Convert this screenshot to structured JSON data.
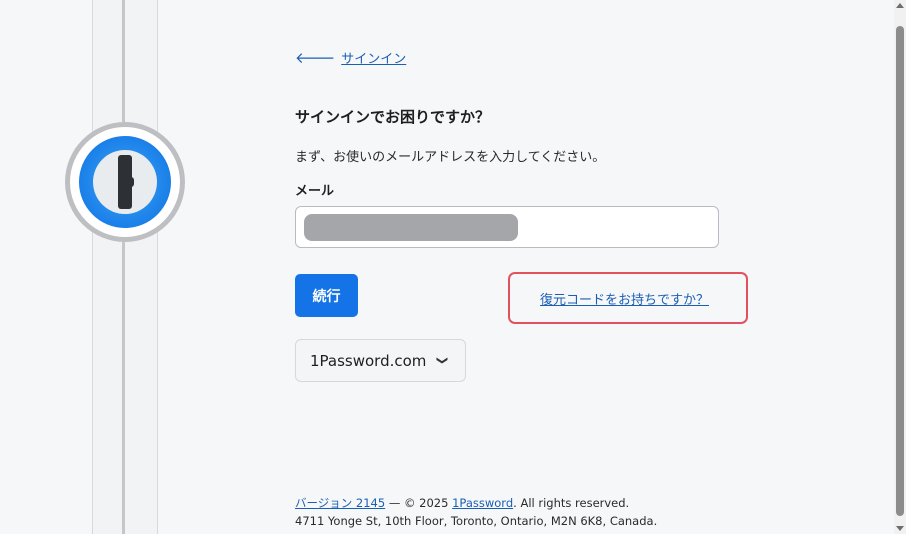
{
  "back_link": {
    "label": "サインイン"
  },
  "heading": "サインインでお困りですか？",
  "instruction": "まず、お使いのメールアドレスを入力してください。",
  "email": {
    "label": "メール",
    "value": ""
  },
  "continue_button": "続行",
  "recovery_link": "復元コードをお持ちですか？",
  "domain_select": {
    "value": "1Password.com"
  },
  "footer": {
    "version_link": "バージョン 2145",
    "sep_copyright": " — © 2025 ",
    "brand_link": "1Password",
    "rights": ". All rights reserved.",
    "address": "4711 Yonge St, 10th Floor, Toronto, Ontario, M2N 6K8, Canada."
  },
  "colors": {
    "accent": "#1473e6",
    "link": "#1a5fb4",
    "highlight": "#e5505f",
    "background": "#f6f7f9"
  },
  "icons": {
    "back": "arrow-left-icon",
    "dropdown": "chevron-down-icon",
    "logo": "1password-keyhole-logo"
  }
}
